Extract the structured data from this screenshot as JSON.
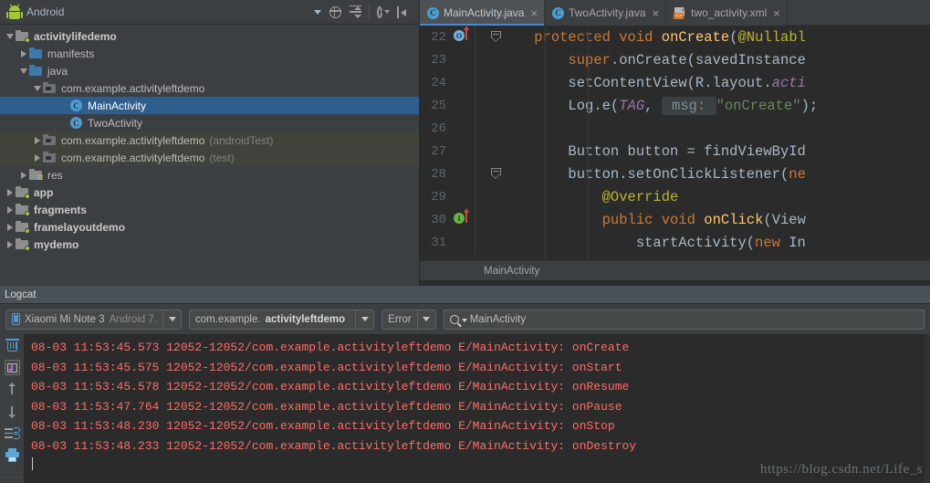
{
  "project_panel": {
    "title": "Android",
    "dropdown_icon": "chevron-down-icon",
    "header_icons": [
      "locate-icon",
      "collapse-all-icon",
      "settings-icon",
      "hide-icon"
    ],
    "tree": [
      {
        "label": "activitylifedemo",
        "suffix": "",
        "depth": 0,
        "twist": "open",
        "icon": "module-folder",
        "bold": true,
        "selected": false,
        "test": false
      },
      {
        "label": "manifests",
        "suffix": "",
        "depth": 1,
        "twist": "closed",
        "icon": "folder-blue",
        "bold": false,
        "selected": false,
        "test": false
      },
      {
        "label": "java",
        "suffix": "",
        "depth": 1,
        "twist": "open",
        "icon": "folder-blue",
        "bold": false,
        "selected": false,
        "test": false
      },
      {
        "label": "com.example.activityleftdemo",
        "suffix": "",
        "depth": 2,
        "twist": "open",
        "icon": "package-folder",
        "bold": false,
        "selected": false,
        "test": false
      },
      {
        "label": "MainActivity",
        "suffix": "",
        "depth": 4,
        "twist": "none",
        "icon": "class-icon",
        "bold": false,
        "selected": true,
        "test": false
      },
      {
        "label": "TwoActivity",
        "suffix": "",
        "depth": 4,
        "twist": "none",
        "icon": "class-icon",
        "bold": false,
        "selected": false,
        "test": false
      },
      {
        "label": "com.example.activityleftdemo",
        "suffix": "(androidTest)",
        "depth": 2,
        "twist": "closed",
        "icon": "package-folder",
        "bold": false,
        "selected": false,
        "test": true
      },
      {
        "label": "com.example.activityleftdemo",
        "suffix": "(test)",
        "depth": 2,
        "twist": "closed",
        "icon": "package-folder",
        "bold": false,
        "selected": false,
        "test": true
      },
      {
        "label": "res",
        "suffix": "",
        "depth": 1,
        "twist": "closed",
        "icon": "res-folder",
        "bold": false,
        "selected": false,
        "test": false
      },
      {
        "label": "app",
        "suffix": "",
        "depth": 0,
        "twist": "closed",
        "icon": "module-folder",
        "bold": true,
        "selected": false,
        "test": false
      },
      {
        "label": "fragments",
        "suffix": "",
        "depth": 0,
        "twist": "closed",
        "icon": "module-folder",
        "bold": true,
        "selected": false,
        "test": false
      },
      {
        "label": "framelayoutdemo",
        "suffix": "",
        "depth": 0,
        "twist": "closed",
        "icon": "module-folder",
        "bold": true,
        "selected": false,
        "test": false
      },
      {
        "label": "mydemo",
        "suffix": "",
        "depth": 0,
        "twist": "closed",
        "icon": "module-folder",
        "bold": true,
        "selected": false,
        "test": false
      }
    ]
  },
  "editor": {
    "tabs": [
      {
        "label": "MainActivity.java",
        "icon": "java-class-icon",
        "active": true,
        "close": "×"
      },
      {
        "label": "TwoActivity.java",
        "icon": "java-class-icon",
        "active": false,
        "close": "×"
      },
      {
        "label": "two_activity.xml",
        "icon": "xml-file-icon",
        "active": false,
        "close": "×"
      }
    ],
    "breadcrumb": "MainActivity",
    "lines": [
      {
        "no": "22",
        "marker": "override-blue",
        "fold": "collapse-top",
        "segments": [
          {
            "t": "    ",
            "c": "pl"
          },
          {
            "t": "protected",
            "c": "kw"
          },
          {
            "t": " ",
            "c": "pl"
          },
          {
            "t": "void",
            "c": "kw"
          },
          {
            "t": " ",
            "c": "pl"
          },
          {
            "t": "onCreate",
            "c": "fn"
          },
          {
            "t": "(",
            "c": "pl"
          },
          {
            "t": "@Nullabl",
            "c": "an"
          }
        ]
      },
      {
        "no": "23",
        "marker": "",
        "fold": "",
        "segments": [
          {
            "t": "        ",
            "c": "pl"
          },
          {
            "t": "super",
            "c": "kw"
          },
          {
            "t": ".onCreate(savedInstance",
            "c": "pl"
          }
        ]
      },
      {
        "no": "24",
        "marker": "",
        "fold": "",
        "segments": [
          {
            "t": "        setContentView(R.layout.",
            "c": "pl"
          },
          {
            "t": "acti",
            "c": "fld italic"
          }
        ]
      },
      {
        "no": "25",
        "marker": "",
        "fold": "",
        "segments": [
          {
            "t": "        Log.e(",
            "c": "pl"
          },
          {
            "t": "TAG",
            "c": "fld italic"
          },
          {
            "t": ", ",
            "c": "pl"
          },
          {
            "t": " msg: ",
            "c": "hint"
          },
          {
            "t": "\"onCreate\"",
            "c": "str"
          },
          {
            "t": ");",
            "c": "pl"
          }
        ]
      },
      {
        "no": "26",
        "marker": "",
        "fold": "",
        "segments": []
      },
      {
        "no": "27",
        "marker": "",
        "fold": "",
        "segments": [
          {
            "t": "        Button button = findViewById",
            "c": "pl"
          }
        ]
      },
      {
        "no": "28",
        "marker": "",
        "fold": "collapse-mid",
        "segments": [
          {
            "t": "        button.setOnClickListener(",
            "c": "pl"
          },
          {
            "t": "ne",
            "c": "kw"
          }
        ]
      },
      {
        "no": "29",
        "marker": "",
        "fold": "",
        "segments": [
          {
            "t": "            ",
            "c": "pl"
          },
          {
            "t": "@Override",
            "c": "an"
          }
        ]
      },
      {
        "no": "30",
        "marker": "override-green",
        "fold": "",
        "segments": [
          {
            "t": "            ",
            "c": "pl"
          },
          {
            "t": "public",
            "c": "kw"
          },
          {
            "t": " ",
            "c": "pl"
          },
          {
            "t": "void",
            "c": "kw"
          },
          {
            "t": " ",
            "c": "pl"
          },
          {
            "t": "onClick",
            "c": "fn"
          },
          {
            "t": "(View",
            "c": "pl"
          }
        ]
      },
      {
        "no": "31",
        "marker": "",
        "fold": "",
        "segments": [
          {
            "t": "                startActivity(",
            "c": "pl"
          },
          {
            "t": "new",
            "c": "kw"
          },
          {
            "t": " In",
            "c": "pl"
          }
        ]
      }
    ]
  },
  "logcat": {
    "tab_label": "Logcat",
    "device": {
      "name": "Xiaomi Mi Note 3",
      "os": "Android 7."
    },
    "process": {
      "prefix": "com.example.",
      "bold": "activityleftdemo",
      "suffix": " "
    },
    "level": "Error",
    "search": {
      "value": "MainActivity",
      "icon": "search-icon"
    },
    "side_icons": [
      "trash-icon",
      "scroll-to-end-icon",
      "arrow-up-icon",
      "arrow-down-icon",
      "soft-wrap-icon",
      "print-icon"
    ],
    "lines": [
      "08-03 11:53:45.573 12052-12052/com.example.activityleftdemo E/MainActivity: onCreate",
      "08-03 11:53:45.575 12052-12052/com.example.activityleftdemo E/MainActivity: onStart",
      "08-03 11:53:45.578 12052-12052/com.example.activityleftdemo E/MainActivity: onResume",
      "08-03 11:53:47.764 12052-12052/com.example.activityleftdemo E/MainActivity: onPause",
      "08-03 11:53:48.230 12052-12052/com.example.activityleftdemo E/MainActivity: onStop",
      "08-03 11:53:48.233 12052-12052/com.example.activityleftdemo E/MainActivity: onDestroy"
    ],
    "watermark": "https://blog.csdn.net/Life_s"
  },
  "colors": {
    "panel_bg": "#3c3f41",
    "editor_bg": "#2b2b2b",
    "selection_blue": "#2f5d8c",
    "log_error_red": "#ff6b68",
    "accent_tab": "#4a88c7",
    "android_green": "#a4c639"
  }
}
